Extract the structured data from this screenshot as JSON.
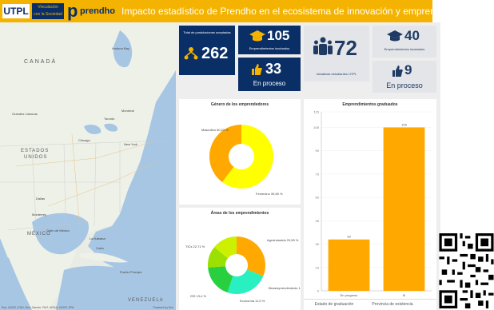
{
  "header": {
    "utpl_logo": "UTPL",
    "vinculacion_line1": "Vinculación",
    "vinculacion_line2": "con la Sociedad",
    "prendho_logo_p": "p",
    "prendho_logo_word": "prendho",
    "title": "Impacto estadístico de Prendho en el ecosistema de innovación y emprendimiento"
  },
  "map": {
    "labels": {
      "canada": "CANADÁ",
      "estados": "ESTADOS",
      "unidos": "UNIDOS",
      "mexico": "MÉXICO",
      "cuba": "Cuba",
      "venezuela": "VENEZUELA",
      "golfo": "Golfo de México",
      "la_habana": "La Habana",
      "toronto": "Toronto",
      "chicago": "Chicago",
      "montreal": "Montreal",
      "new_york": "New York",
      "puerto_principe": "Puerto Príncipe",
      "monterrey": "Monterrey",
      "grandes_llanuras": "Grandes Llanuras",
      "dallas": "Dallas",
      "hudson": "Hudson Bay"
    },
    "attribution": "Esri, USGS | FAO, Esri, Garmin, FAO, NOAA, USGS, EPA",
    "powered": "Powered by Esri"
  },
  "kpis": {
    "total": {
      "label": "Total de postulaciones aceptadas",
      "value": "262",
      "icon": "people-network-icon"
    },
    "emprendimientos": {
      "value": "105",
      "label": "Emprendimientos incubados",
      "icon": "graduation-cap-icon"
    },
    "en_proceso_emp": {
      "value": "33",
      "label": "En proceso",
      "icon": "thumbs-up-icon"
    },
    "iniciativas": {
      "value": "72",
      "label": "Iniciativas estudiantes UTPL",
      "icon": "group-icon"
    },
    "incubados2": {
      "value": "40",
      "label": "Emprendimientos incubados",
      "icon": "graduation-cap-icon"
    },
    "en_proceso_ini": {
      "value": "9",
      "label": "En proceso",
      "icon": "thumbs-up-icon"
    }
  },
  "charts": {
    "genero": {
      "title": "Género de los emprendedores",
      "labels": [
        "Masculino 60,21 %",
        "Femenino 39,69 %"
      ],
      "colors": [
        "#ffff00",
        "#ffa800"
      ]
    },
    "areas": {
      "title": "Áreas de los emprendimientos",
      "labels": [
        "Agroindustria 29,55 %",
        "TICs 22,71 %",
        "Biosemprendimiento 17,54 %",
        "Economía 11,5 %",
        "ISS 13,4 %"
      ],
      "colors": [
        "#ffa800",
        "#28f0c0",
        "#28d040",
        "#9be000",
        "#ccf000"
      ]
    },
    "graduados": {
      "title": "Emprendimientos graduados",
      "tabs": [
        "Estado de graduación",
        "Provincia de existencia"
      ]
    }
  },
  "chart_data": [
    {
      "type": "pie",
      "title": "Género de los emprendedores",
      "categories": [
        "Masculino",
        "Femenino"
      ],
      "values": [
        60.21,
        39.69
      ]
    },
    {
      "type": "pie",
      "title": "Áreas de los emprendimientos",
      "categories": [
        "Agroindustria",
        "TICs",
        "Biosemprendimiento",
        "Economía",
        "ISS"
      ],
      "values": [
        29.55,
        22.71,
        17.54,
        11.5,
        13.4
      ]
    },
    {
      "type": "bar",
      "title": "Emprendimientos graduados",
      "categories": [
        "En progreso",
        "Sí"
      ],
      "values": [
        33,
        105
      ],
      "ylim": [
        0,
        115
      ],
      "yticks": [
        0,
        15,
        30,
        45,
        60,
        75,
        90,
        105
      ],
      "ytick_labels": [
        "115",
        "105",
        "90",
        "75",
        "60",
        "45",
        "30",
        "0"
      ],
      "color": "#ffa800"
    }
  ]
}
